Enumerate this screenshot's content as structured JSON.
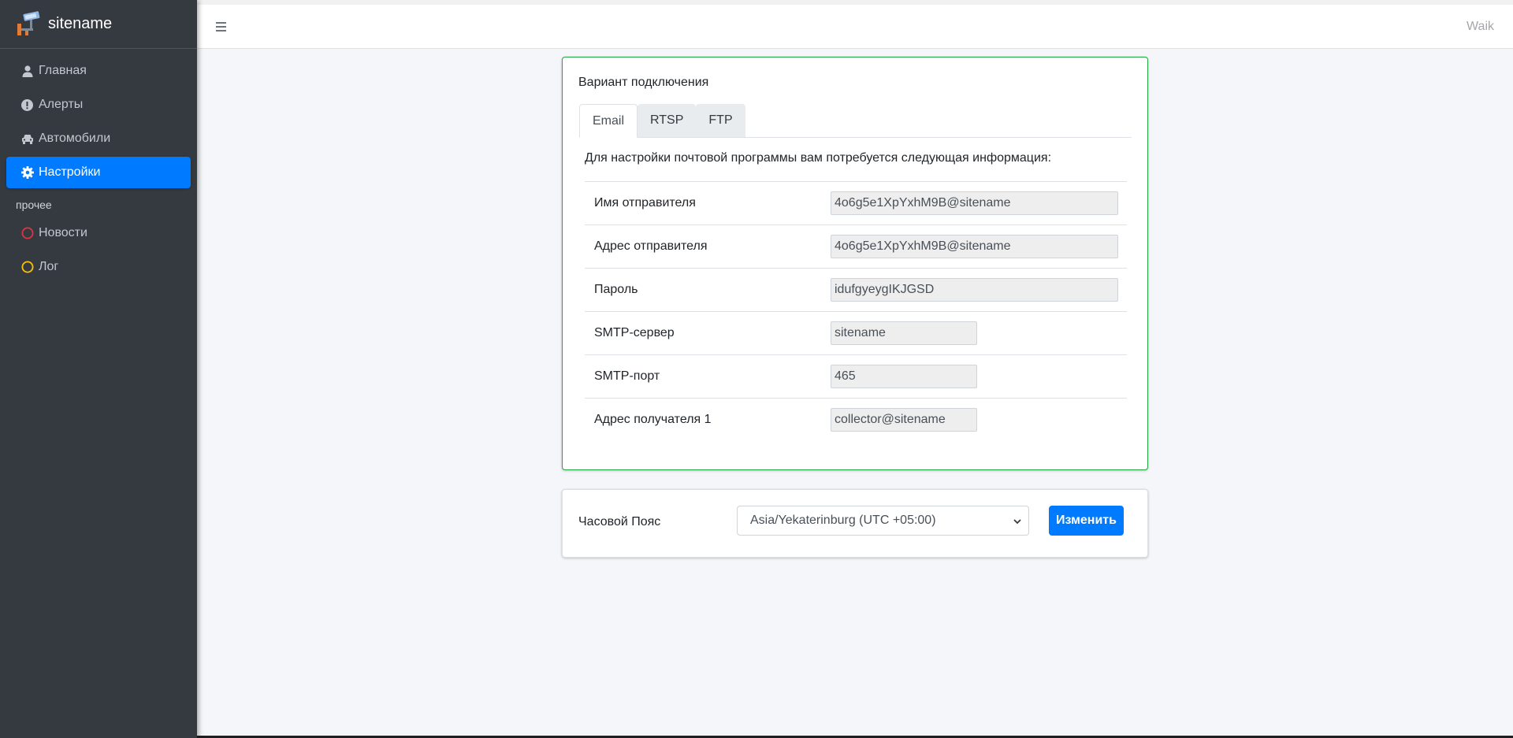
{
  "brand": {
    "name": "sitename"
  },
  "sidebar": {
    "items": [
      {
        "label": "Главная",
        "icon": "user-icon"
      },
      {
        "label": "Алерты",
        "icon": "exclamation-circle-icon"
      },
      {
        "label": "Автомобили",
        "icon": "car-icon"
      },
      {
        "label": "Настройки",
        "icon": "gear-icon",
        "active": true
      }
    ],
    "section_header": "прочее",
    "other_items": [
      {
        "label": "Новости",
        "icon": "circle-outline-icon",
        "color": "#dc3545"
      },
      {
        "label": "Лог",
        "icon": "circle-outline-icon",
        "color": "#ffc107"
      }
    ]
  },
  "topbar": {
    "user": "Waik"
  },
  "connection": {
    "title": "Вариант подключения",
    "tabs": [
      {
        "label": "Email",
        "active": true
      },
      {
        "label": "RTSP"
      },
      {
        "label": "FTP"
      }
    ],
    "intro": "Для настройки почтовой программы вам потребуется следующая информация:",
    "rows": [
      {
        "label": "Имя отправителя",
        "value": "4o6g5e1XpYxhM9B@sitename"
      },
      {
        "label": "Адрес отправителя",
        "value": "4o6g5e1XpYxhM9B@sitename"
      },
      {
        "label": "Пароль",
        "value": "idufgyeygIKJGSD"
      },
      {
        "label": "SMTP-сервер",
        "value": "sitename"
      },
      {
        "label": "SMTP-порт",
        "value": "465"
      },
      {
        "label": "Адрес получателя 1",
        "value": "collector@sitename"
      }
    ]
  },
  "timezone": {
    "label": "Часовой Пояс",
    "selected": "Asia/Yekaterinburg (UTC +05:00)",
    "button": "Изменить"
  },
  "colors": {
    "sidebar_bg": "#343a40",
    "accent": "#007bff",
    "card_border": "#28a745"
  }
}
